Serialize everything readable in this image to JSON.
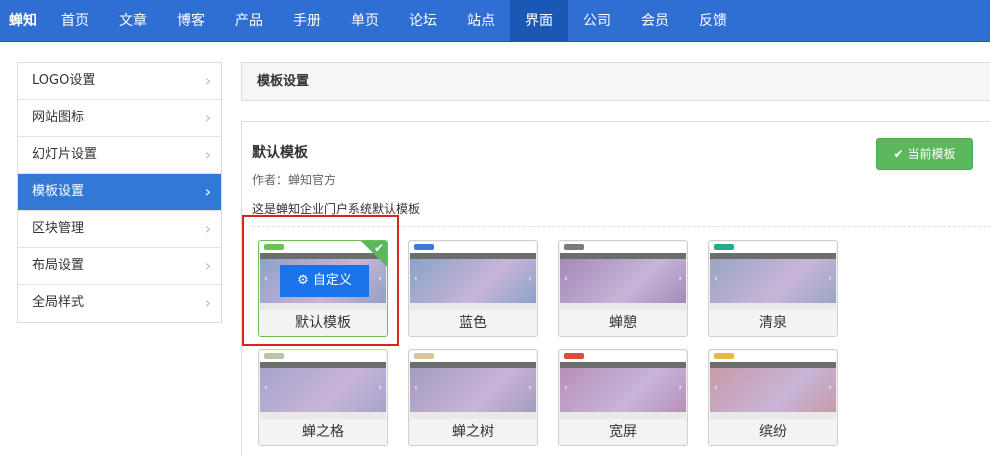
{
  "navbar": {
    "brand": "蝉知",
    "items": [
      "首页",
      "文章",
      "博客",
      "产品",
      "手册",
      "单页",
      "论坛",
      "站点",
      "界面",
      "公司",
      "会员",
      "反馈"
    ],
    "active_index": 8
  },
  "sidebar": {
    "items": [
      "LOGO设置",
      "网站图标",
      "幻灯片设置",
      "模板设置",
      "区块管理",
      "布局设置",
      "全局样式"
    ],
    "active_index": 3
  },
  "header": {
    "title": "模板设置"
  },
  "template": {
    "name": "默认模板",
    "author": "作者：蝉知官方",
    "description": "这是蝉知企业门户系统默认模板",
    "current_button": "当前模板",
    "current_icon": "check-icon"
  },
  "cards": [
    {
      "label": "默认模板",
      "selected": true,
      "customize_label": "自定义",
      "hero": "#8fa0c9",
      "accent": "#6fbf55"
    },
    {
      "label": "蓝色",
      "selected": false,
      "hero": "#8aa2c8",
      "accent": "#3d78d6"
    },
    {
      "label": "蝉憩",
      "selected": false,
      "hero": "#a38ab8",
      "accent": "#7a7a7a"
    },
    {
      "label": "清泉",
      "selected": false,
      "hero": "#9aa6c4",
      "accent": "#2aa88f"
    },
    {
      "label": "蝉之格",
      "selected": false,
      "hero": "#a6a3cc",
      "accent": "#b8c6a8"
    },
    {
      "label": "蝉之树",
      "selected": false,
      "hero": "#a49bbf",
      "accent": "#d8c69a"
    },
    {
      "label": "宽屏",
      "selected": false,
      "hero": "#b88fb9",
      "accent": "#e04a3a"
    },
    {
      "label": "缤纷",
      "selected": false,
      "hero": "#c99aa8",
      "accent": "#e8b84a"
    }
  ],
  "colors": {
    "navbar_bg": "#2f6ed2",
    "nav_active_bg": "#1b58b5",
    "sidebar_active_bg": "#3478d6",
    "success_green": "#5cb85c",
    "highlight_red": "#d9261c"
  }
}
